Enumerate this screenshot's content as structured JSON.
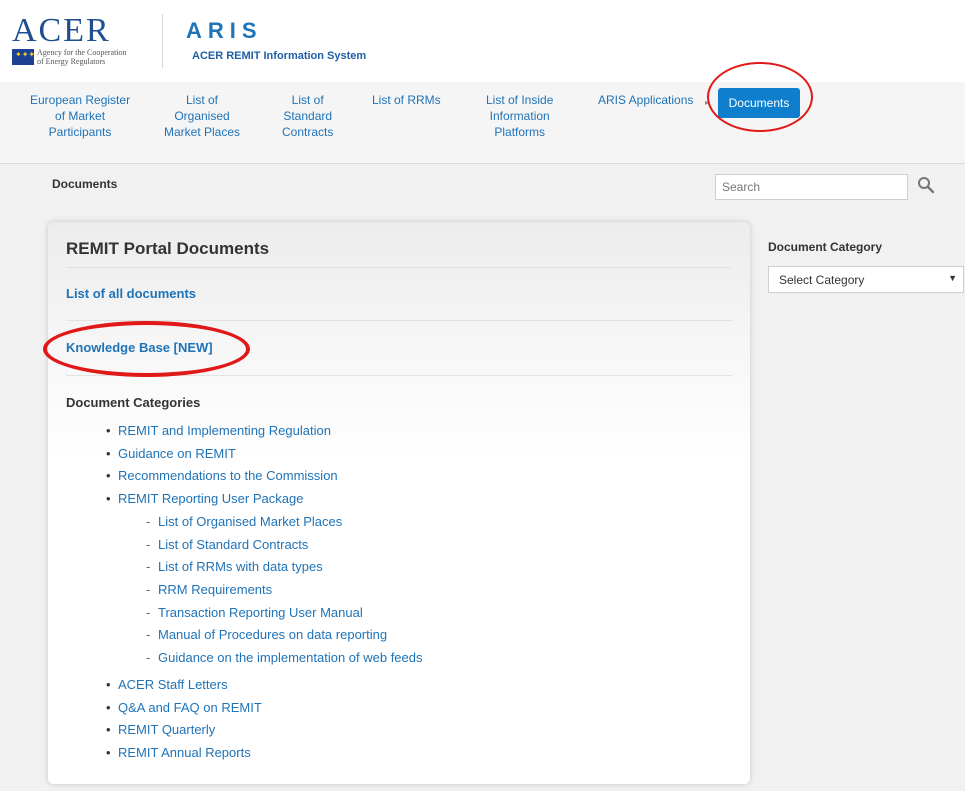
{
  "header": {
    "acer_word": "ACER",
    "acer_tagline_1": "Agency for the Cooperation",
    "acer_tagline_2": "of Energy Regulators",
    "aris_word": "ARIS",
    "aris_subtitle": "ACER REMIT Information System"
  },
  "nav": {
    "items": [
      {
        "line1": "European Register",
        "line2": "of Market",
        "line3": "Participants"
      },
      {
        "line1": "List of",
        "line2": "Organised",
        "line3": "Market Places"
      },
      {
        "line1": "List of",
        "line2": "Standard",
        "line3": "Contracts"
      },
      {
        "line1": "List of RRMs"
      },
      {
        "line1": "List of Inside",
        "line2": "Information",
        "line3": "Platforms"
      },
      {
        "line1": "ARIS Applications"
      }
    ],
    "active": "Documents"
  },
  "breadcrumb": "Documents",
  "search": {
    "placeholder": "Search"
  },
  "main": {
    "title": "REMIT Portal Documents",
    "all_docs_link": "List of all documents",
    "kb_link": "Knowledge Base [NEW]",
    "categories_heading": "Document Categories",
    "categories_top": [
      "REMIT and Implementing Regulation",
      "Guidance on REMIT",
      "Recommendations to the Commission",
      "REMIT Reporting User Package"
    ],
    "reporting_subitems": [
      "List of Organised Market Places",
      "List of Standard Contracts",
      "List of RRMs with data types",
      "RRM Requirements",
      "Transaction Reporting User Manual",
      "Manual of Procedures on data reporting",
      "Guidance on the implementation of web feeds"
    ],
    "categories_bottom": [
      "ACER Staff Letters",
      "Q&A and FAQ on REMIT",
      "REMIT Quarterly",
      "REMIT Annual Reports"
    ]
  },
  "sidebar": {
    "title": "Document Category",
    "select_value": "Select Category"
  },
  "colors": {
    "link": "#1f73b7",
    "active_nav": "#0f7fcd",
    "annotation": "#e01818"
  }
}
